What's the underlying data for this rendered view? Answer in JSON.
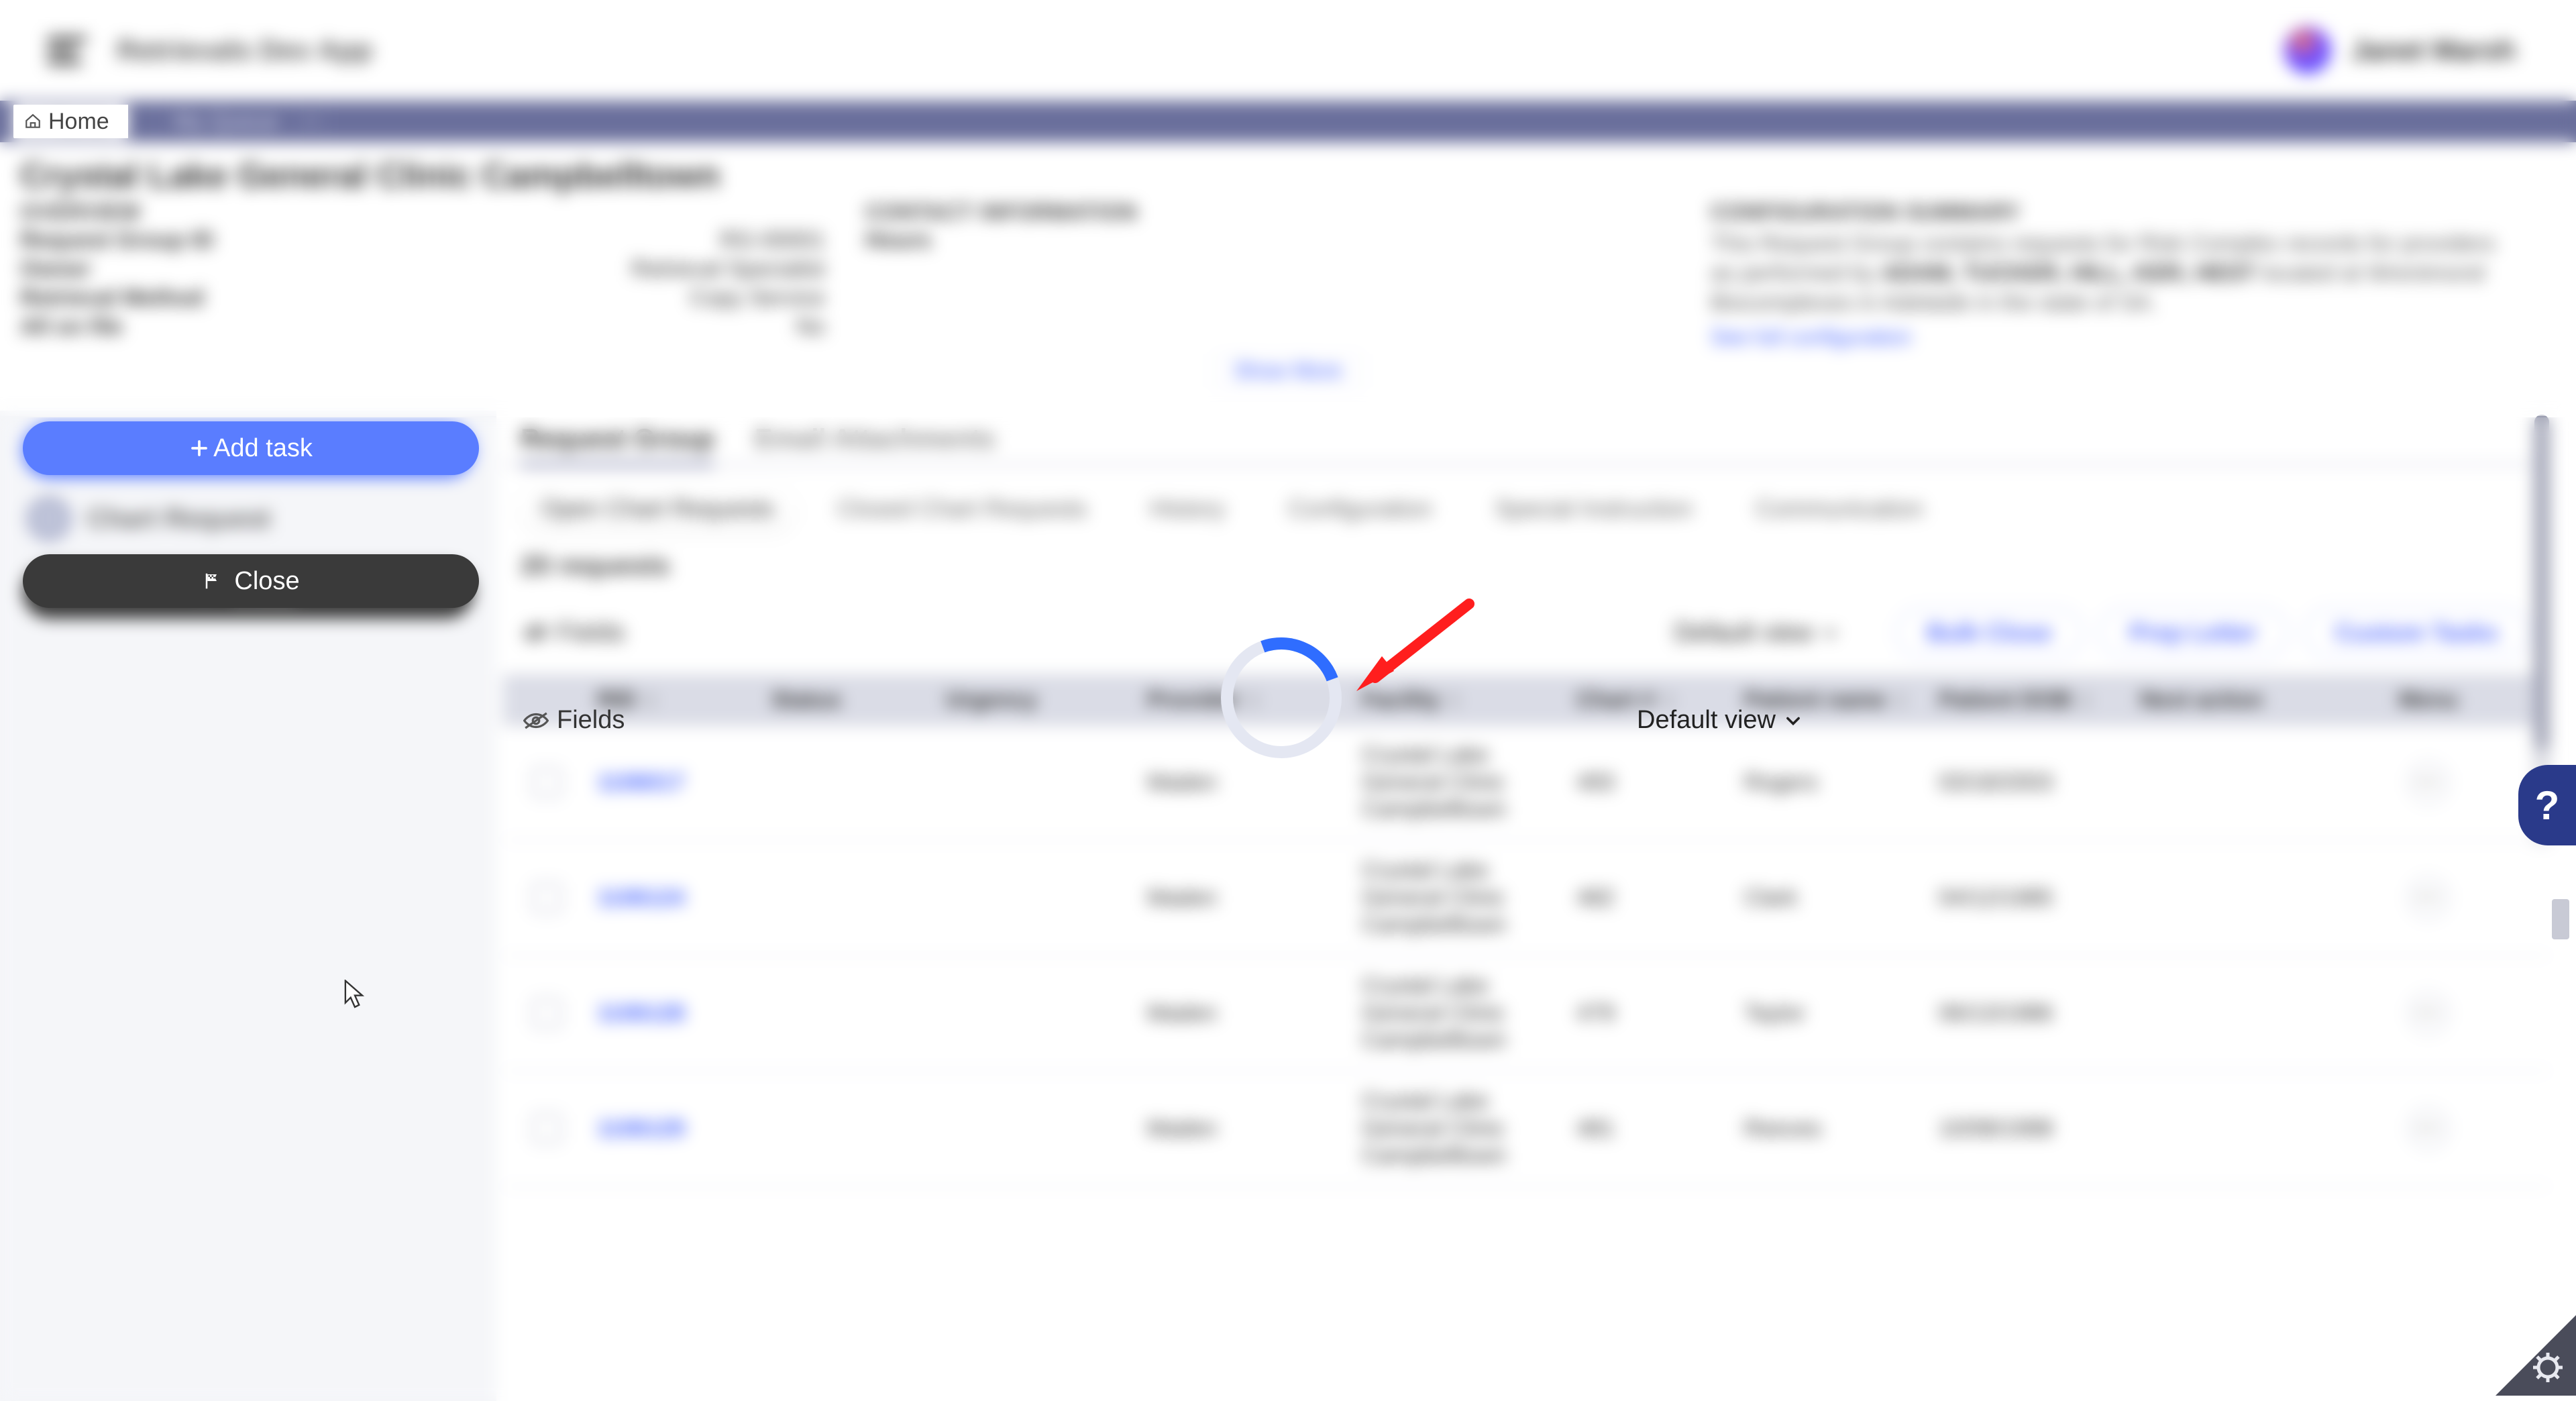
{
  "topbar": {
    "app_name": "Retrievals Dev App",
    "user_name": "Janet Marsh"
  },
  "nav": {
    "home_label": "Home",
    "open_tab_label": "My Queue"
  },
  "page": {
    "title": "Crystal Lake General Clinic Campbelltown",
    "overview": {
      "heading": "OVERVIEW",
      "row1_label": "Request Group ID",
      "row1_value": "RG-00001",
      "row2_label": "Owner",
      "row2_value": "Retrieval Specialist",
      "row3_label": "Retrieval Method",
      "row3_value": "Copy Service",
      "row4_label": "All on file",
      "row4_value": "No"
    },
    "contact": {
      "heading": "CONTACT INFORMATION",
      "row1_label": "Hours"
    },
    "config": {
      "heading": "CONFIGURATION SUMMARY",
      "text_a": "This Request Group contains requests for Risk Complex records for providers as performed by ",
      "text_strong": "ADAM, TUCKER, HILL, KER, HEST",
      "text_b": " located at Wrentmond Biocomplexes in Adelaide in the state of SA.",
      "link": "See full configuration"
    },
    "show_more": "Show More"
  },
  "sidebar": {
    "add_task": "Add task",
    "task_name": "Chart Request",
    "close": "Close"
  },
  "main": {
    "tabs_primary": {
      "t1": "Request Group",
      "t2": "Email Attachments"
    },
    "tabs_secondary": {
      "t1": "Open Chart Requests",
      "t2": "Closed Chart Requests",
      "t3": "History",
      "t4": "Configuration",
      "t5": "Special Instruction",
      "t6": "Communication"
    },
    "count_line": "20 requests",
    "fields_label": "Fields",
    "default_view": "Default view",
    "actions": {
      "a1": "Bulk Close",
      "a2": "Prep Letter",
      "a3": "Custom Tasks"
    },
    "columns": {
      "c1": "RID",
      "c2": "Status",
      "c3": "Urgency",
      "c4": "Provider",
      "c5": "Facility",
      "c6": "Chart #",
      "c7": "Patient name",
      "c8": "Patient DOB",
      "c9": "Next action",
      "c10": "Menu"
    },
    "rows": [
      {
        "rid": "1106017",
        "provider": "Maden",
        "facility": "Crystal Lake General Clinic Campbelltown",
        "chart": "493",
        "pname": "Rogers",
        "pdob": "03/18/2003"
      },
      {
        "rid": "1106124",
        "provider": "Maden",
        "facility": "Crystal Lake General Clinic Campbelltown",
        "chart": "482",
        "pname": "Clark",
        "pdob": "04/12/1985"
      },
      {
        "rid": "1106128",
        "provider": "Maden",
        "facility": "Crystal Lake General Clinic Campbelltown",
        "chart": "479",
        "pname": "Taylor",
        "pdob": "06/13/1986"
      },
      {
        "rid": "1106129",
        "provider": "Maden",
        "facility": "Crystal Lake General Clinic Campbelltown",
        "chart": "481",
        "pname": "Reeves",
        "pdob": "10/08/1998"
      }
    ]
  },
  "help_label": "?"
}
